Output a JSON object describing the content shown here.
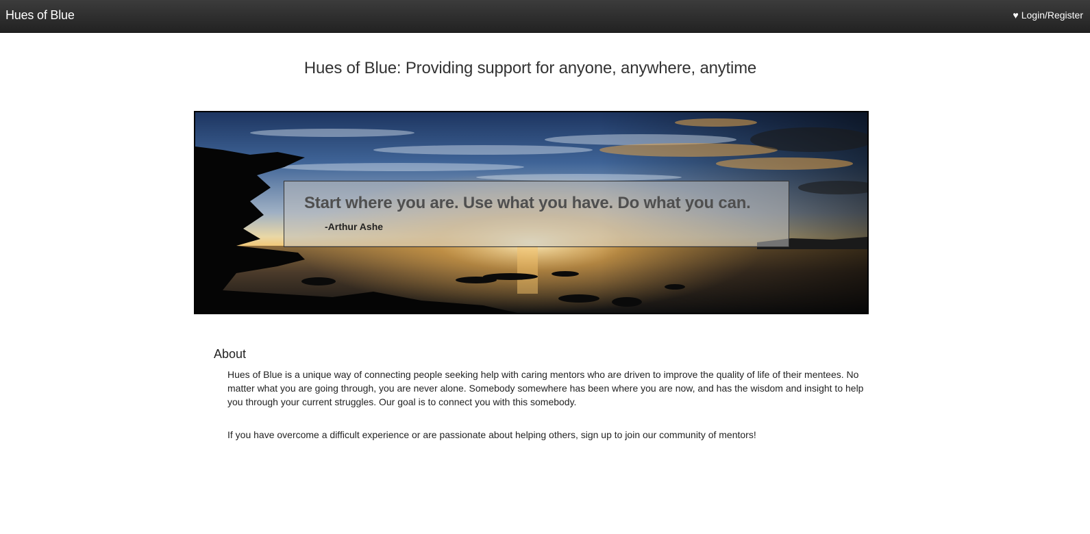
{
  "navbar": {
    "brand": "Hues of Blue",
    "login_label": "Login/Register",
    "login_icon": "heart-icon"
  },
  "page_title": "Hues of Blue: Providing support for anyone, anywhere, anytime",
  "hero": {
    "image": "sunset-over-lake-photo",
    "quote": "Start where you are. Use what you have. Do what you can.",
    "author": "-Arthur Ashe"
  },
  "about": {
    "heading": "About",
    "paragraph1": "Hues of Blue is a unique way of connecting people seeking help with caring mentors who are driven to improve the quality of life of their mentees. No matter what you are going through, you are never alone. Somebody somewhere has been where you are now, and has the wisdom and insight to help you through your current struggles. Our goal is to connect you with this somebody.",
    "paragraph2": "If you have overcome a difficult experience or are passionate about helping others, sign up to join our community of mentors!"
  },
  "colors": {
    "navbar_bg": "#222222",
    "text": "#333333"
  }
}
